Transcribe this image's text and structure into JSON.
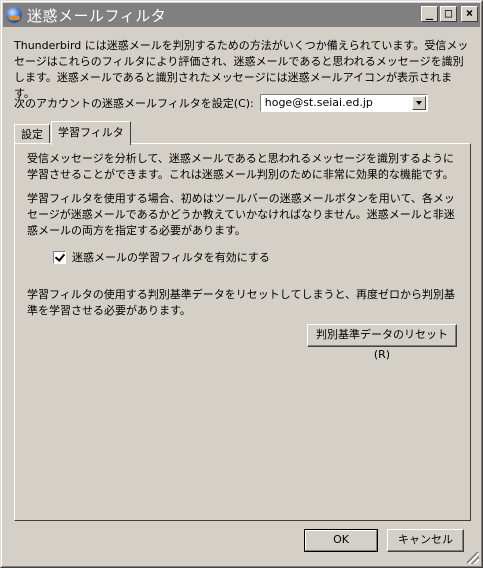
{
  "window": {
    "title": "迷惑メールフィルタ",
    "controls": {
      "minimize": "_",
      "maximize": "□",
      "close": "×"
    }
  },
  "intro_text": "Thunderbird には迷惑メールを判別するための方法がいくつか備えられています。受信メッセージはこれらのフィルタにより評価され、迷惑メールであると思われるメッセージを識別します。迷惑メールであると識別されたメッセージには迷惑メールアイコンが表示されます。",
  "account": {
    "label": "次のアカウントの迷惑メールフィルタを設定(C):",
    "selected": "hoge@st.seiai.ed.jp"
  },
  "tabs": [
    {
      "label": "設定"
    },
    {
      "label": "学習フィルタ"
    }
  ],
  "panel": {
    "para1": "受信メッセージを分析して、迷惑メールであると思われるメッセージを識別するように学習させることができます。これは迷惑メール判別のために非常に効果的な機能です。",
    "para2": "学習フィルタを使用する場合、初めはツールバーの迷惑メールボタンを用いて、各メッセージが迷惑メールであるかどうか教えていかなければなりません。迷惑メールと非迷惑メールの両方を指定する必要があります。",
    "checkbox_label": "迷惑メールの学習フィルタを有効にする",
    "checkbox_checked": true,
    "para3": "学習フィルタの使用する判別基準データをリセットしてしまうと、再度ゼロから判別基準を学習させる必要があります。",
    "reset_button": "判別基準データのリセット(R)"
  },
  "footer": {
    "ok": "OK",
    "cancel": "キャンセル"
  }
}
